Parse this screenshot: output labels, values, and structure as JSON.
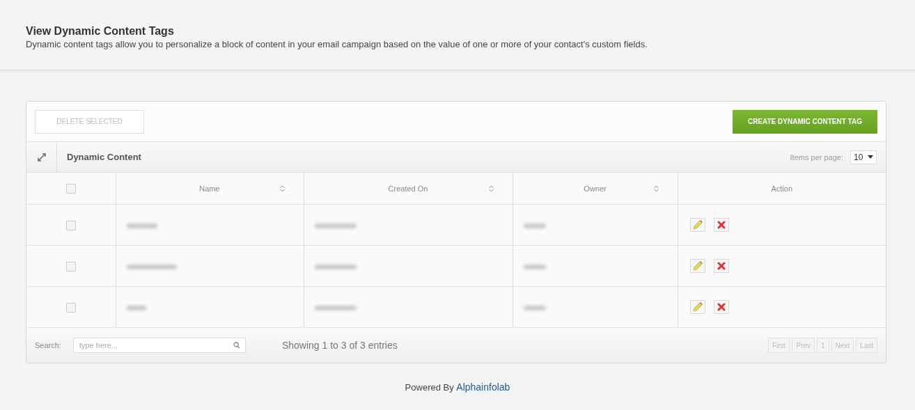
{
  "header": {
    "title": "View Dynamic Content Tags",
    "description": "Dynamic content tags allow you to personalize a block of content in your email campaign based on the value of one or more of your contact's custom fields."
  },
  "toolbar": {
    "delete_button": {
      "label": "DELETE SELECTED",
      "disabled": true
    },
    "create_button": {
      "label": "CREATE DYNAMIC CONTENT TAG"
    }
  },
  "panel": {
    "title": "Dynamic Content",
    "items_per_page_label": "Items per page:",
    "items_per_page": "10"
  },
  "table": {
    "select_all": {
      "checked": false
    },
    "columns": [
      {
        "label": "Name",
        "kind": "sortable"
      },
      {
        "label": "Created On",
        "kind": "sortable"
      },
      {
        "label": "Owner",
        "kind": "sortable"
      },
      {
        "label": "Action",
        "kind": "plain"
      }
    ],
    "rows": [
      {
        "checked": false
      },
      {
        "checked": false
      },
      {
        "checked": false
      }
    ]
  },
  "footer": {
    "search_label": "Search:",
    "search_placeholder": "type here...",
    "summary": "Showing 1 to 3 of 3 entries",
    "pagination": [
      {
        "label": "First",
        "disabled": true
      },
      {
        "label": "Prev",
        "disabled": true
      },
      {
        "label": "1",
        "disabled": true
      },
      {
        "label": "Next",
        "disabled": true
      },
      {
        "label": "Last",
        "disabled": true
      }
    ]
  },
  "powered_by": {
    "prefix": "Powered By",
    "link": "Alphainfolab"
  }
}
